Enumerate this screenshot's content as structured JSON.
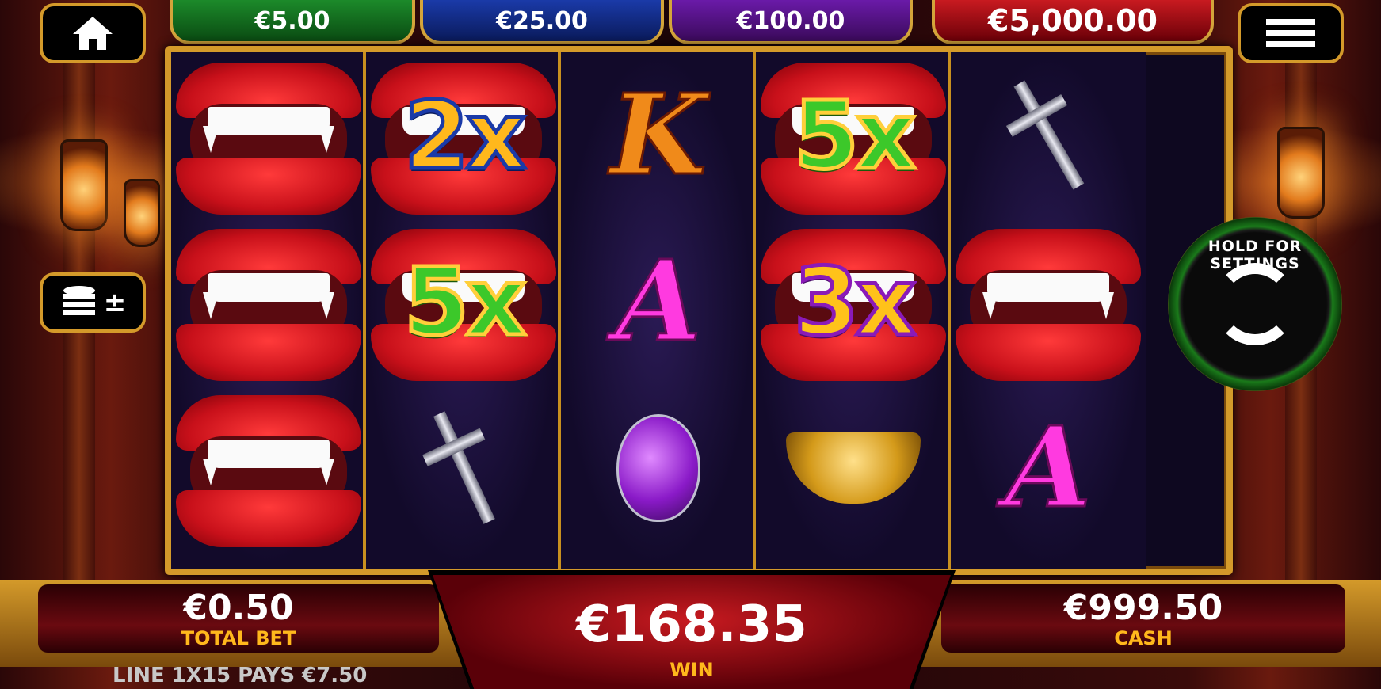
{
  "jackpots": [
    "€5.00",
    "€25.00",
    "€100.00",
    "€5,000.00"
  ],
  "buttons": {
    "home_icon": "home-icon",
    "menu_icon": "hamburger-menu-icon",
    "coins_icon": "coin-stack-plus-minus-icon",
    "coins_symbol": "±"
  },
  "spin": {
    "label": "HOLD FOR SETTINGS",
    "icon": "refresh-arrows-icon"
  },
  "reels": [
    [
      "lips",
      "lips",
      "lips"
    ],
    [
      "2x",
      "5x",
      "cross"
    ],
    [
      "K",
      "A",
      "potion"
    ],
    [
      "5x",
      "3x",
      "necklace"
    ],
    [
      "cross",
      "lips",
      "A"
    ]
  ],
  "bottom": {
    "total_bet_value": "€0.50",
    "total_bet_label": "TOTAL BET",
    "win_value": "€168.35",
    "win_label": "WIN",
    "cash_value": "€999.50",
    "cash_label": "CASH",
    "line_info": "LINE 1X15 PAYS €7.50"
  },
  "colors": {
    "gold": "#d49a2a",
    "win_red": "#c81a20",
    "label_gold": "#ffb81c"
  }
}
